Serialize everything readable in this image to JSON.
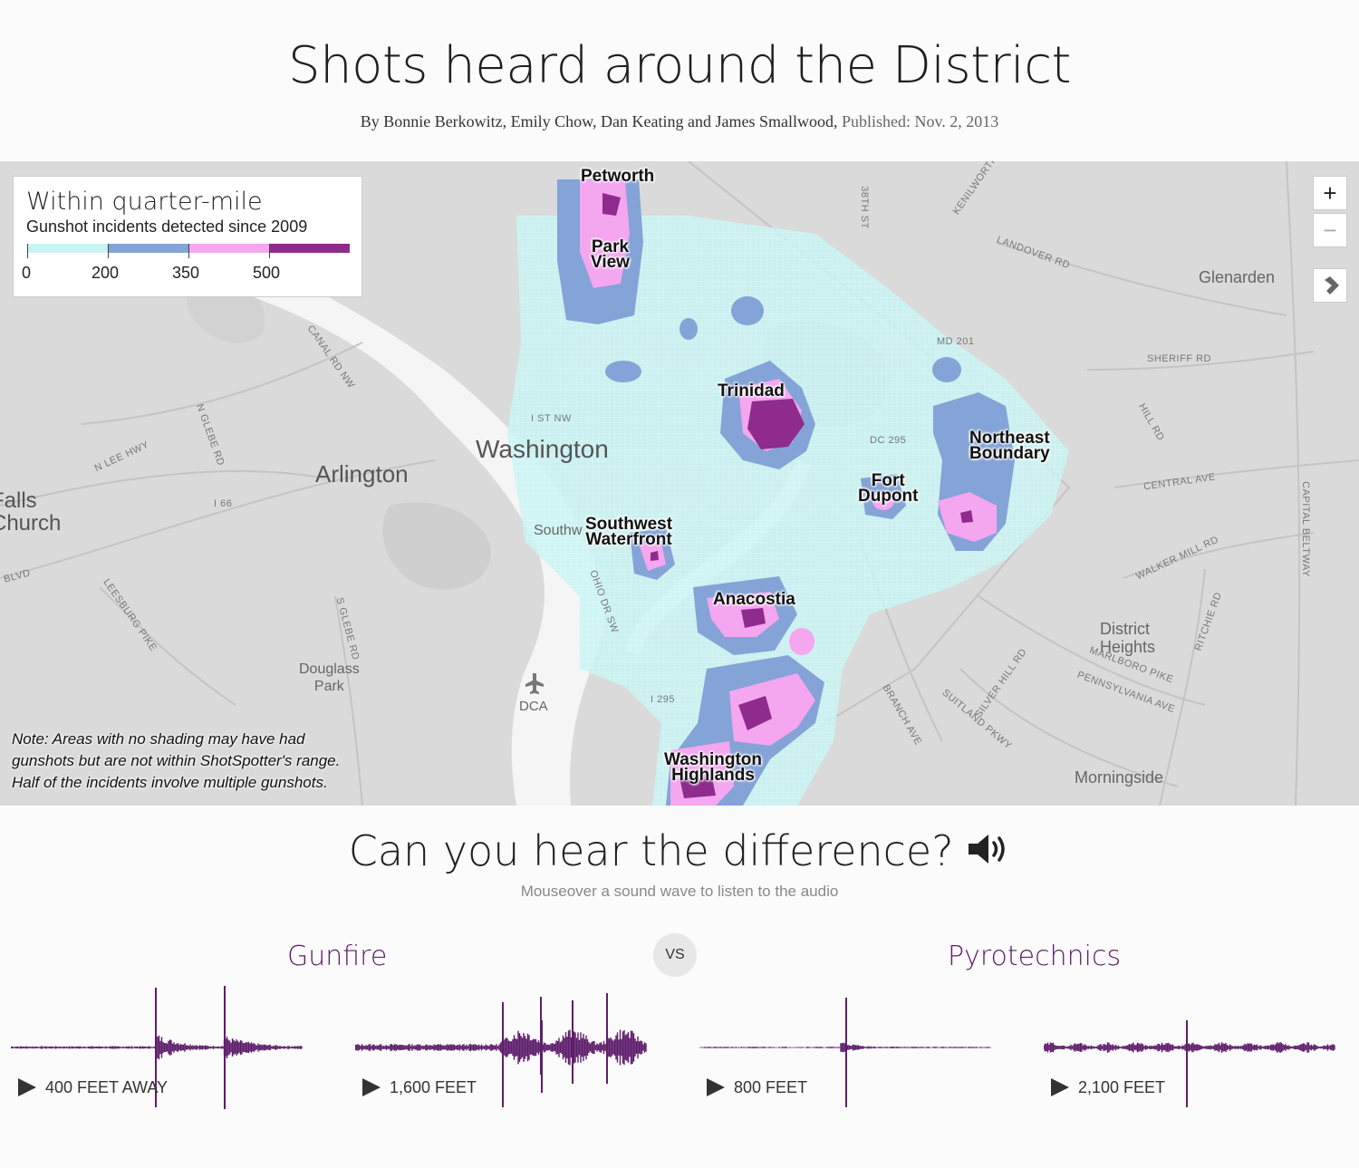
{
  "header": {
    "title": "Shots heard around the District",
    "byline": "By Bonnie Berkowitz, Emily Chow, Dan Keating and James Smallwood,",
    "published": "Published: Nov. 2, 2013"
  },
  "map": {
    "legend": {
      "title": "Within quarter-mile",
      "subtitle": "Gunshot incidents detected since 2009",
      "ticks": [
        "0",
        "200",
        "350",
        "500"
      ],
      "colors": [
        "#c8f3f3",
        "#84a3d6",
        "#f4a6ef",
        "#8e2b8c"
      ]
    },
    "controls": {
      "zoom_in": "+",
      "zoom_out": "−",
      "locate_icon": "locate-icon"
    },
    "neighborhoods": {
      "petworth": "Petworth",
      "park_view": "Park\nView",
      "trinidad": "Trinidad",
      "northeast_boundary": "Northeast\nBoundary",
      "fort_dupont": "Fort\nDupont",
      "southwest_waterfront": "Southwest\nWaterfront",
      "anacostia": "Anacostia",
      "washington_highlands": "Washington\nHighlands"
    },
    "places": {
      "washington": "Washington",
      "arlington": "Arlington",
      "falls_church": "Falls\nChurch",
      "glenarden": "Glenarden",
      "douglass_park": "Douglass\nPark",
      "dca": "DCA",
      "district_heights": "District\nHeights",
      "morningside": "Morningside",
      "southw": "Southw"
    },
    "roads": {
      "canal": "CANAL RD NW",
      "n_glebe": "N GLEBE RD",
      "n_lee": "N LEE HWY",
      "i66": "I 66",
      "leesburg": "LEESBURG PIKE",
      "s_glebe": "S GLEBE RD",
      "ohio": "OHIO DR SW",
      "i295": "I 295",
      "st38": "38TH ST",
      "kenilworth": "KENILWORTH",
      "landover": "LANDOVER RD",
      "sheriff": "SHERIFF RD",
      "central": "CENTRAL AVE",
      "walker": "WALKER MILL RD",
      "pennsylvania": "PENNSYLVANIA AVE",
      "marlboro": "MARLBORO PIKE",
      "silver_hill": "SILVER HILL RD",
      "suitland": "SUITLAND PKWY",
      "branch": "BRANCH AVE",
      "capital_beltway": "CAPITAL BELTWAY",
      "ritchie": "RITCHIE RD",
      "hill": "HILL RD",
      "dc295": "DC 295",
      "md201": "MD 201",
      "i_st": "I ST NW",
      "blvd": "BLVD"
    },
    "note": "Note: Areas with no shading may have had\ngunshots but are not within ShotSpotter's range.\nHalf of the incidents involve multiple gunshots."
  },
  "audio": {
    "title": "Can you hear the difference?",
    "speaker_icon": "speaker-icon",
    "hint": "Mouseover a sound wave to listen to the audio",
    "vs": "VS",
    "groups": [
      "Gunfire",
      "Pyrotechnics"
    ],
    "clips": [
      {
        "label": "400 FEET AWAY",
        "group": "Gunfire"
      },
      {
        "label": "1,600 FEET",
        "group": "Gunfire"
      },
      {
        "label": "800 FEET",
        "group": "Pyrotechnics"
      },
      {
        "label": "2,100 FEET",
        "group": "Pyrotechnics"
      }
    ],
    "wave_color": "#5e1e6b"
  }
}
